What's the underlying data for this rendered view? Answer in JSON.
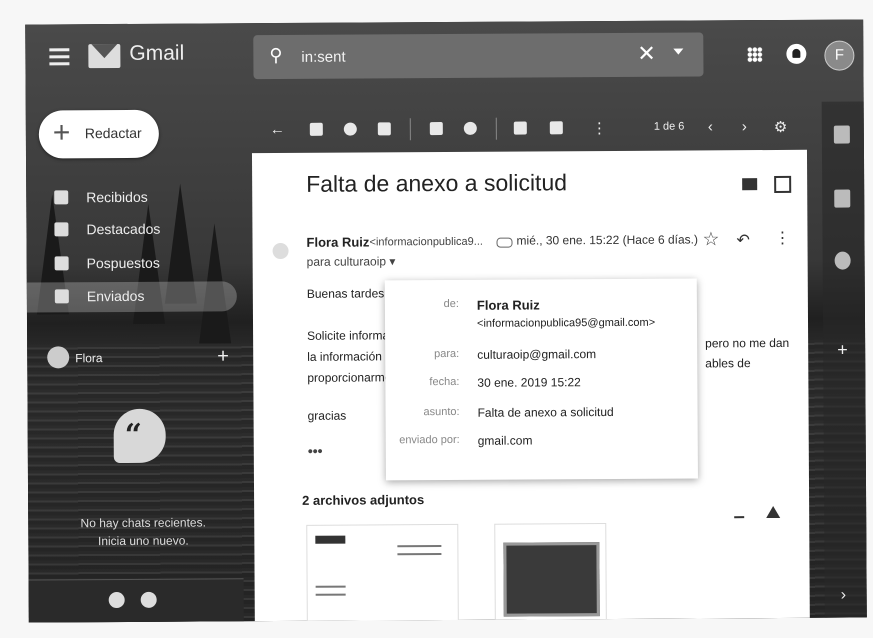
{
  "topbar": {
    "app_name": "Gmail",
    "search_value": "in:sent",
    "avatar_letter": "F"
  },
  "sidebar": {
    "compose_label": "Redactar",
    "items": [
      {
        "label": "Recibidos",
        "icon": "inbox-icon"
      },
      {
        "label": "Destacados",
        "icon": "star-icon"
      },
      {
        "label": "Pospuestos",
        "icon": "clock-icon"
      },
      {
        "label": "Enviados",
        "icon": "send-icon",
        "active": true
      }
    ],
    "user_name": "Flora",
    "no_chats_line1": "No hay chats recientes.",
    "no_chats_line2": "Inicia uno nuevo."
  },
  "toolbar": {
    "pager": "1 de 6"
  },
  "email": {
    "subject": "Falta de anexo a solicitud",
    "sender_name": "Flora Ruiz",
    "sender_email": "<informacionpublica9...",
    "date": "mié., 30 ene. 15:22 (Hace 6 días.)",
    "to_line": "para culturaoip",
    "greeting": "Buenas tardes",
    "body_line1": "Solicite informac",
    "body_line1_cont": "pero no me dan",
    "body_line2": "la información q",
    "body_line2_cont": "ables de",
    "body_line3": "proporcionarmel",
    "closing": "gracias",
    "ellipsis": "•••",
    "attachments_title": "2 archivos adjuntos"
  },
  "details": {
    "de_label": "de:",
    "de_name": "Flora Ruiz",
    "de_email": "<informacionpublica95@gmail.com>",
    "para_label": "para:",
    "para_value": "culturaoip@gmail.com",
    "fecha_label": "fecha:",
    "fecha_value": "30 ene. 2019 15:22",
    "asunto_label": "asunto:",
    "asunto_value": "Falta de anexo a solicitud",
    "enviado_label": "enviado por:",
    "enviado_value": "gmail.com"
  }
}
